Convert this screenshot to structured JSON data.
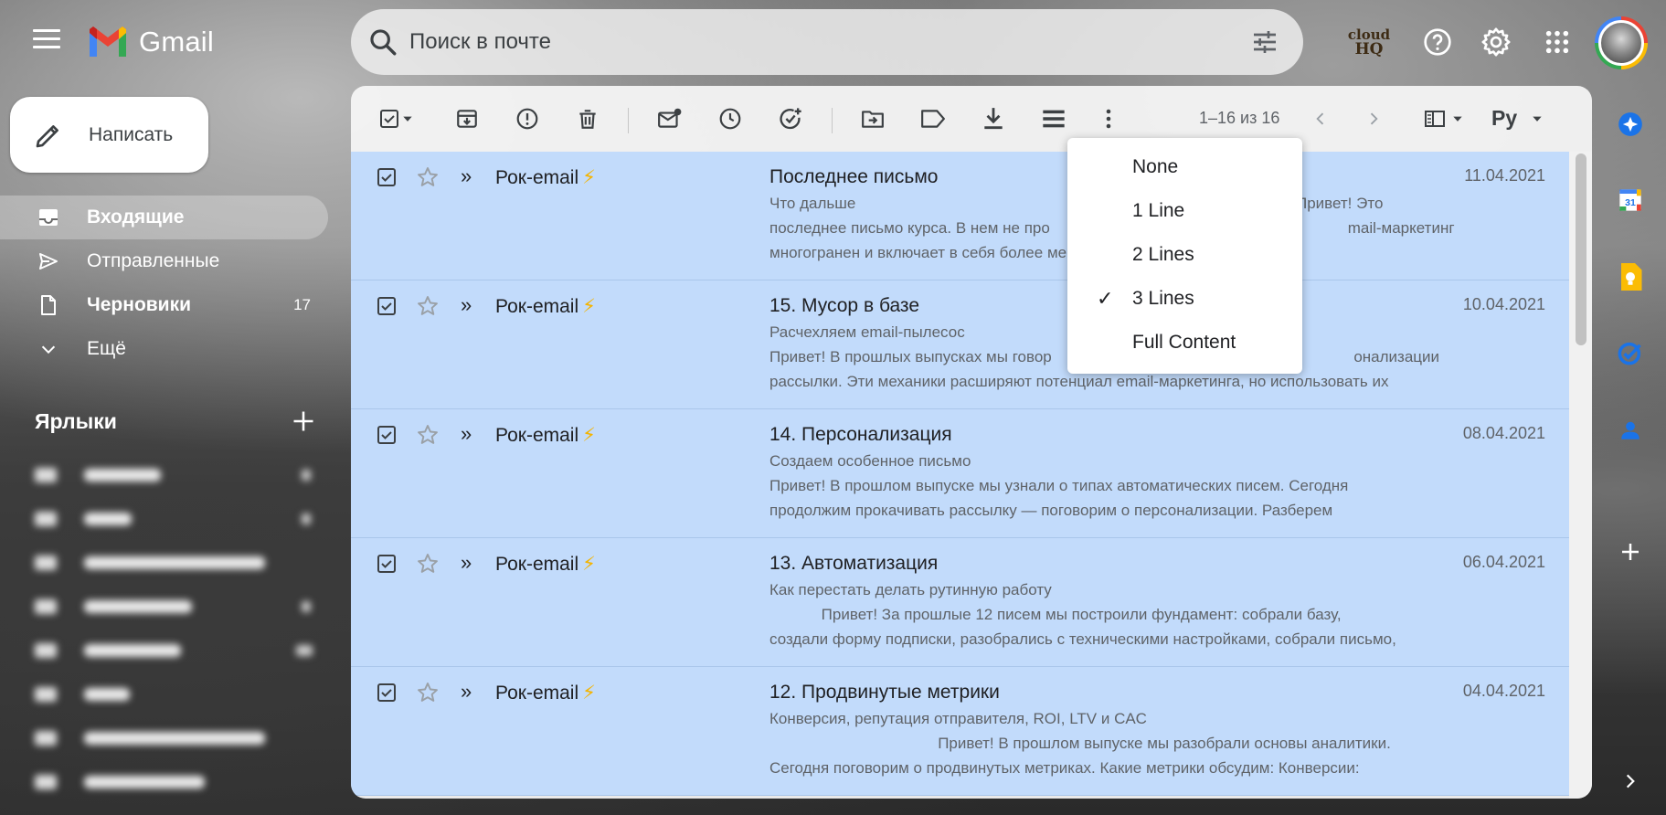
{
  "app": {
    "name": "Gmail"
  },
  "search": {
    "placeholder": "Поиск в почте"
  },
  "header": {
    "cloudhq_line1": "cloud",
    "cloudhq_line2": "HQ"
  },
  "compose": {
    "label": "Написать"
  },
  "nav": {
    "items": [
      {
        "label": "Входящие",
        "count": ""
      },
      {
        "label": "Отправленные",
        "count": ""
      },
      {
        "label": "Черновики",
        "count": "17"
      },
      {
        "label": "Ещё",
        "count": ""
      }
    ],
    "labels_title": "Ярлыки"
  },
  "toolbar": {
    "pager": "1–16 из 16",
    "language": "Ру"
  },
  "emails": [
    {
      "sender": "Рок-email",
      "sender_emoji": "⚡",
      "subject": "Последнее письмо",
      "line1": "Что дальше",
      "line2": "последнее письмо курса. В нем не про                                                                     mail-маркетинг",
      "line3": "многогранен и включает в себя более                                                                        мер, можно",
      "line1_tail": "Привет! Это",
      "date": "11.04.2021"
    },
    {
      "sender": "Рок-email",
      "sender_emoji": "⚡",
      "subject": "15. Мусор в базе",
      "line1": "Расчехляем email-пылесос",
      "line2": "Привет! В прошлых выпусках мы говор                                                                      онализации",
      "line3": "рассылки. Эти механики расширяют потенциал email-маркетинга, но использовать их",
      "line1_tail": "",
      "date": "10.04.2021"
    },
    {
      "sender": "Рок-email",
      "sender_emoji": "⚡",
      "subject": "14. Персонализация",
      "line1": "Создаем особенное письмо",
      "line2": "Привет! В прошлом выпуске мы узнали о типах автоматических писем. Сегодня",
      "line3": "продолжим прокачивать рассылку — поговорим о персонализации. Разберем",
      "line1_tail": "",
      "date": "08.04.2021"
    },
    {
      "sender": "Рок-email",
      "sender_emoji": "⚡",
      "subject": "13. Автоматизация",
      "line1": "Как перестать делать рутинную работу",
      "line2": "            Привет! За прошлые 12 писем мы построили фундамент: собрали базу,",
      "line3": "создали форму подписки, разобрались с техническими настройками, собрали письмо,",
      "line1_tail": "",
      "date": "06.04.2021"
    },
    {
      "sender": "Рок-email",
      "sender_emoji": "⚡",
      "subject": "12. Продвинутые метрики",
      "line1": "Конверсия, репутация отправителя, ROI, LTV и CAC",
      "line2": "                                       Привет! В прошлом выпуске мы разобрали основы аналитики.",
      "line3": "Сегодня поговорим о продвинутых метриках. Какие метрики обсудим: Конверсии:",
      "line1_tail": "",
      "date": "04.04.2021"
    }
  ],
  "density_menu": {
    "items": [
      {
        "label": "None",
        "checked": ""
      },
      {
        "label": "1 Line",
        "checked": ""
      },
      {
        "label": "2 Lines",
        "checked": ""
      },
      {
        "label": "3 Lines",
        "checked": "✓"
      },
      {
        "label": "Full Content",
        "checked": ""
      }
    ]
  },
  "side_panel": {
    "calendar_day": "31"
  },
  "colors": {
    "selected_row": "#c2dbfb",
    "accent_blue": "#1a73e8",
    "keep_yellow": "#fbbc04",
    "bolt": "#f4b400"
  }
}
